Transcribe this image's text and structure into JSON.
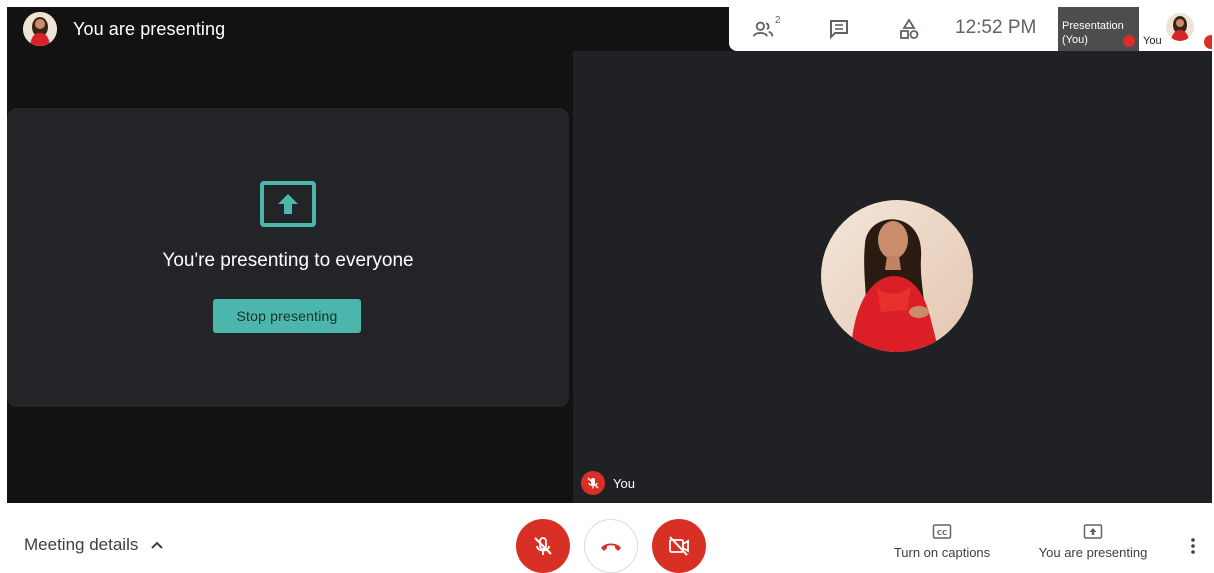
{
  "header": {
    "title": "You are presenting"
  },
  "presenter_card": {
    "message": "You're presenting to everyone",
    "stop_button_label": "Stop presenting"
  },
  "tile": {
    "name": "You"
  },
  "top_panel": {
    "participants_count": "2",
    "time": "12:52 PM",
    "presentation_thumb": {
      "line1": "Presentation",
      "line2": "(You)"
    },
    "self_thumb_label": "You"
  },
  "bottom_bar": {
    "meeting_details_label": "Meeting details",
    "captions_label": "Turn on captions",
    "presenting_label": "You are presenting"
  },
  "colors": {
    "accent_teal": "#4db6ac",
    "danger_red": "#d93025",
    "stage_dark": "#121212",
    "tile_dark": "#202124"
  },
  "icons": {
    "participants": "people-icon",
    "chat": "chat-icon",
    "activities": "shapes-icon",
    "mute": "mic-off-icon",
    "hangup": "phone-hangup-icon",
    "camera_off": "camera-off-icon",
    "captions": "cc-icon",
    "present": "present-screen-icon",
    "more": "more-vert-icon"
  }
}
